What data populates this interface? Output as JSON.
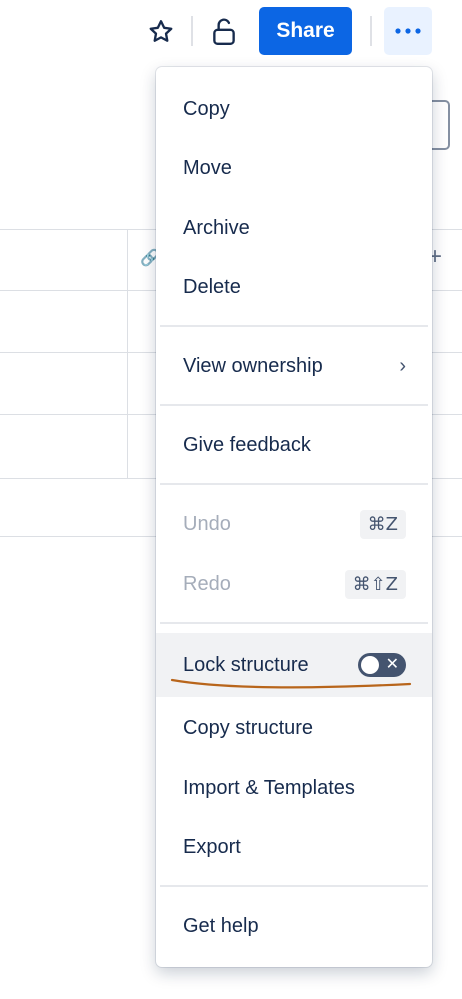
{
  "toolbar": {
    "share_label": "Share",
    "icons": [
      "star-icon",
      "unlock-icon",
      "more-icon"
    ],
    "share_color": "#0c66e4"
  },
  "menu": {
    "items": [
      {
        "label": "Copy"
      },
      {
        "label": "Move"
      },
      {
        "label": "Archive"
      },
      {
        "label": "Delete"
      },
      {
        "label": "View ownership"
      },
      {
        "label": "Give feedback"
      },
      {
        "label": "Undo",
        "shortcut": "⌘Z",
        "disabled": true
      },
      {
        "label": "Redo",
        "shortcut": "⌘⇧Z",
        "disabled": true
      },
      {
        "label": "Lock structure",
        "toggle": false
      },
      {
        "label": "Copy structure"
      },
      {
        "label": "Import & Templates"
      },
      {
        "label": "Export"
      },
      {
        "label": "Get help"
      }
    ]
  }
}
